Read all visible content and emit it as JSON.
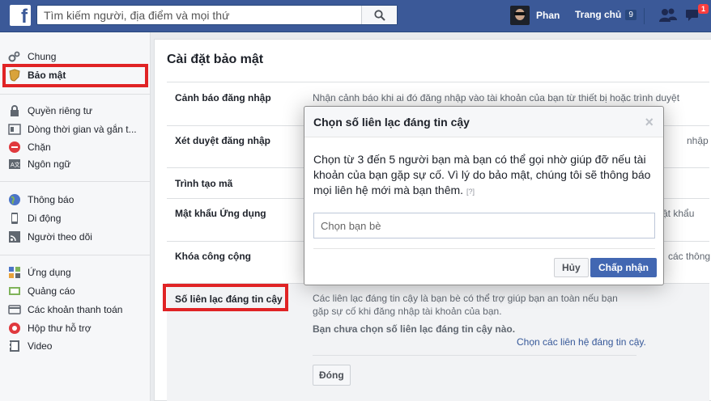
{
  "header": {
    "logo": "f",
    "search_placeholder": "Tìm kiếm người, địa điểm và mọi thứ",
    "profile_name": "Phan",
    "home_label": "Trang chủ",
    "home_count": "9",
    "messages_badge": "1"
  },
  "sidebar": {
    "items": [
      {
        "label": "Chung",
        "icon": "gear-icon"
      },
      {
        "label": "Bảo mật",
        "icon": "shield-icon"
      },
      {
        "label": "Quyền riêng tư",
        "icon": "lock-icon"
      },
      {
        "label": "Dòng thời gian và gắn t...",
        "icon": "timeline-icon"
      },
      {
        "label": "Chặn",
        "icon": "block-icon"
      },
      {
        "label": "Ngôn ngữ",
        "icon": "language-icon"
      },
      {
        "label": "Thông báo",
        "icon": "globe-icon"
      },
      {
        "label": "Di động",
        "icon": "mobile-icon"
      },
      {
        "label": "Người theo dõi",
        "icon": "rss-icon"
      },
      {
        "label": "Ứng dụng",
        "icon": "apps-icon"
      },
      {
        "label": "Quảng cáo",
        "icon": "ads-icon"
      },
      {
        "label": "Các khoản thanh toán",
        "icon": "payment-icon"
      },
      {
        "label": "Hộp thư hỗ trợ",
        "icon": "support-icon"
      },
      {
        "label": "Video",
        "icon": "video-icon"
      }
    ]
  },
  "main": {
    "title": "Cài đặt bảo mật",
    "rows": [
      {
        "label": "Cảnh báo đăng nhập",
        "desc": "Nhận cảnh báo khi ai đó đăng nhập vào tài khoản của bạn từ thiết bị hoặc trình duyệt"
      },
      {
        "label": "Xét duyệt đăng nhập",
        "desc": "nhập"
      },
      {
        "label": "Trình tạo mã",
        "desc": ""
      },
      {
        "label": "Mật khẩu Ứng dụng",
        "desc": "ật khẩu"
      },
      {
        "label": "Khóa công cộng",
        "desc": "các thông"
      }
    ],
    "open_row": {
      "label": "Số liên lạc đáng tin cậy",
      "desc": "Các liên lạc đáng tin cậy là bạn bè có thể trợ giúp bạn an toàn nếu bạn gặp sự cố khi đăng nhập tài khoản của bạn.",
      "warning": "Bạn chưa chọn số liên lạc đáng tin cậy nào.",
      "link": "Chọn các liên hệ đáng tin cậy.",
      "close_label": "Đóng"
    }
  },
  "dialog": {
    "title": "Chọn số liên lạc đáng tin cậy",
    "close": "×",
    "text": "Chọn từ 3 đến 5 người bạn mà bạn có thể gọi nhờ giúp đỡ nếu tài khoản của bạn gặp sự cố. Vì lý do bảo mật, chúng tôi sẽ thông báo mọi liên hệ mới mà bạn thêm.",
    "help": "[?]",
    "input_placeholder": "Chọn bạn bè",
    "cancel_label": "Hủy",
    "ok_label": "Chấp nhận"
  },
  "colors": {
    "brand": "#3b5998",
    "primary_button": "#4267b2",
    "highlight_box": "#e02325"
  }
}
